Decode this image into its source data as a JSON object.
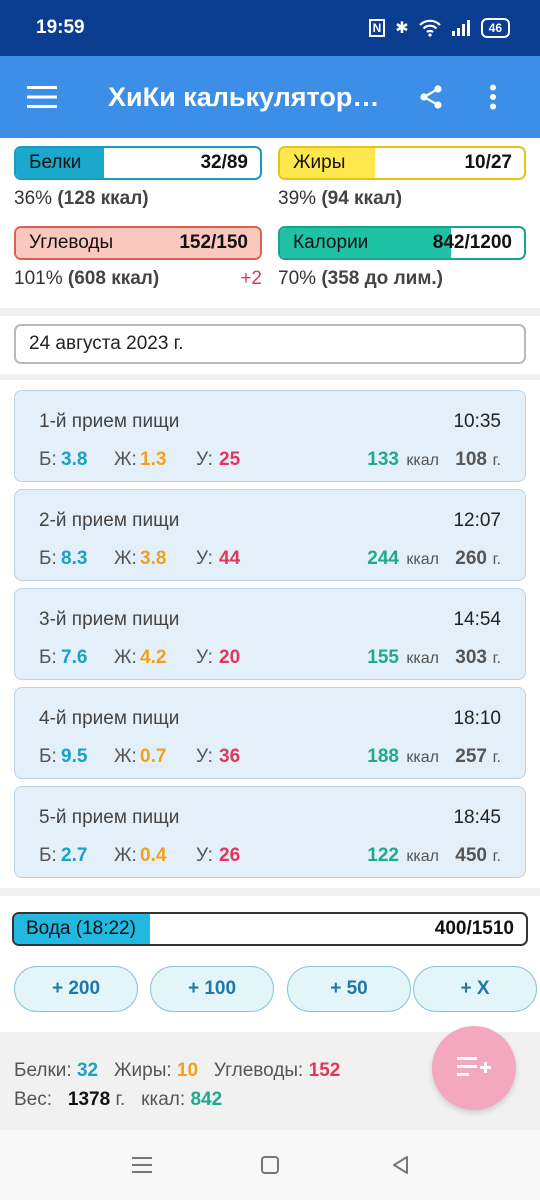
{
  "status_bar": {
    "time": "19:59",
    "nfc": "N",
    "bluetooth": "✱",
    "battery": "46"
  },
  "app_bar": {
    "title": "ХиКи калькулятор…"
  },
  "macros": {
    "protein": {
      "label": "Белки",
      "value": "32/89",
      "fraction": 0.36,
      "summary_pct": "36%",
      "summary_kcal": "(128 ккал)",
      "fill": "#1aa8cc",
      "border": "#1a9cbe"
    },
    "fat": {
      "label": "Жиры",
      "value": "10/27",
      "fraction": 0.39,
      "summary_pct": "39%",
      "summary_kcal": "(94 ккал)",
      "fill": "#ffe84d",
      "border": "#e8c21a"
    },
    "carbs": {
      "label": "Углеводы",
      "value": "152/150",
      "fraction": 1.0,
      "summary_pct": "101%",
      "summary_kcal": "(608 ккал)",
      "delta": "+2",
      "fill": "#fbc8bf",
      "border": "#e0604e"
    },
    "calories": {
      "label": "Калории",
      "value": "842/1200",
      "fraction": 0.7,
      "summary_pct": "70%",
      "summary_kcal": "(358 до лим.)",
      "fill": "#1fc2a4",
      "border": "#17a58b"
    }
  },
  "date": "24 августа 2023 г.",
  "meals": [
    {
      "name": "1-й прием пищи",
      "time": "10:35",
      "protein": "3.8",
      "fat": "1.3",
      "carbs": "25",
      "kcal": "133",
      "weight": "108"
    },
    {
      "name": "2-й прием пищи",
      "time": "12:07",
      "protein": "8.3",
      "fat": "3.8",
      "carbs": "44",
      "kcal": "244",
      "weight": "260"
    },
    {
      "name": "3-й прием пищи",
      "time": "14:54",
      "protein": "7.6",
      "fat": "4.2",
      "carbs": "20",
      "kcal": "155",
      "weight": "303"
    },
    {
      "name": "4-й прием пищи",
      "time": "18:10",
      "protein": "9.5",
      "fat": "0.7",
      "carbs": "36",
      "kcal": "188",
      "weight": "257"
    },
    {
      "name": "5-й прием пищи",
      "time": "18:45",
      "protein": "2.7",
      "fat": "0.4",
      "carbs": "26",
      "kcal": "122",
      "weight": "450"
    }
  ],
  "meal_labels": {
    "protein": "Б:",
    "fat": "Ж:",
    "carbs": "У:",
    "kcal_unit": "ккал",
    "weight_unit": "г."
  },
  "water": {
    "label": "Вода (18:22)",
    "value": "400/1510",
    "fraction": 0.265,
    "fill": "#22b8e0",
    "buttons": [
      "+ 200",
      "+ 100",
      "+ 50",
      "+ X"
    ]
  },
  "footer": {
    "protein_label": "Белки:",
    "protein": "32",
    "fat_label": "Жиры:",
    "fat": "10",
    "carbs_label": "Углеводы:",
    "carbs": "152",
    "weight_label": "Вес:",
    "weight": "1378",
    "weight_unit": "г.",
    "kcal_label": "ккал:",
    "kcal": "842"
  },
  "colors": {
    "protein": "#1aa1c4",
    "fat": "#f0a21c",
    "carbs": "#e0385a",
    "kcal": "#1faa8b",
    "appbar": "#3c8ee6",
    "statusbar": "#0b3d91"
  }
}
